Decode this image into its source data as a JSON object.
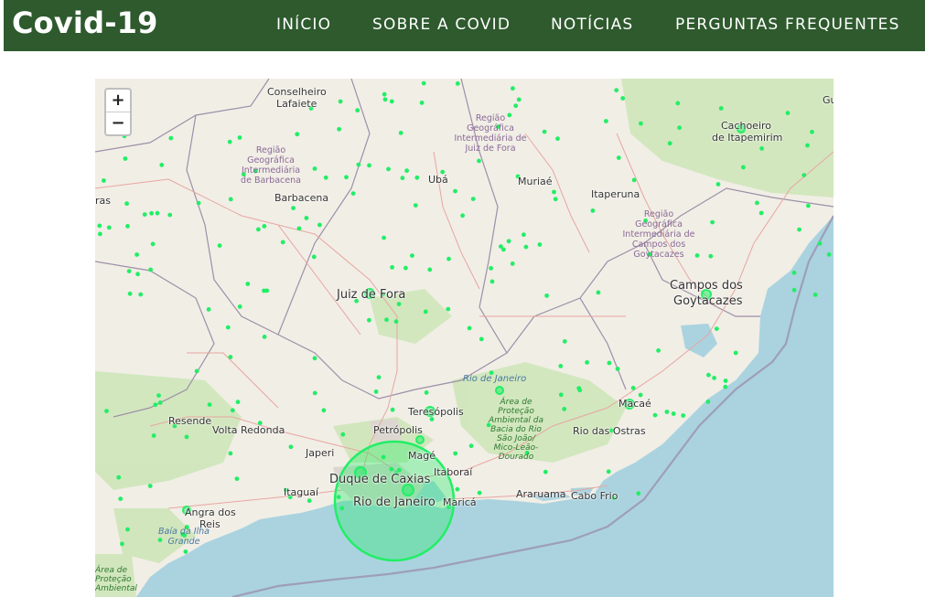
{
  "header": {
    "brand": "Covid-19",
    "nav": [
      "INÍCIO",
      "SOBRE A COVID",
      "NOTÍCIAS",
      "PERGUNTAS FREQUENTES"
    ]
  },
  "map": {
    "zoom_in": "+",
    "zoom_out": "−",
    "marker_color": "#22ee66",
    "cities": [
      "Conselheiro",
      "Lafaiete",
      "Barbacena",
      "Ubá",
      "Muriaé",
      "Itaperuna",
      "Cachoeiro",
      "de Itapemirim",
      "Juiz de Fora",
      "Campos dos",
      "Goytacazes",
      "Resende",
      "Volta Redonda",
      "Teresópolis",
      "Macaé",
      "Petrópolis",
      "Japeri",
      "Magé",
      "Duque de Caxias",
      "Itaboraí",
      "Rio das Ostras",
      "Itaguaí",
      "Rio de Janeiro",
      "Maricá",
      "Araruama",
      "Cabo Frio",
      "Angra dos",
      "Reis",
      "ras",
      "Gu"
    ],
    "regions": [
      "Região Geográfica Intermediária de Barbacena",
      "Região Geográfica Intermediária de Juiz de Fora",
      "Região Geográfica Intermediária de Campos dos Goytacazes"
    ],
    "state_label": "Rio de Janeiro",
    "park_labels": [
      "Área de Proteção Ambiental da Bacia do Rio São João/ Mico-Leão-Dourado",
      "Área de Proteção Ambiental"
    ],
    "water_label": "Baía da Ilha Grande"
  }
}
